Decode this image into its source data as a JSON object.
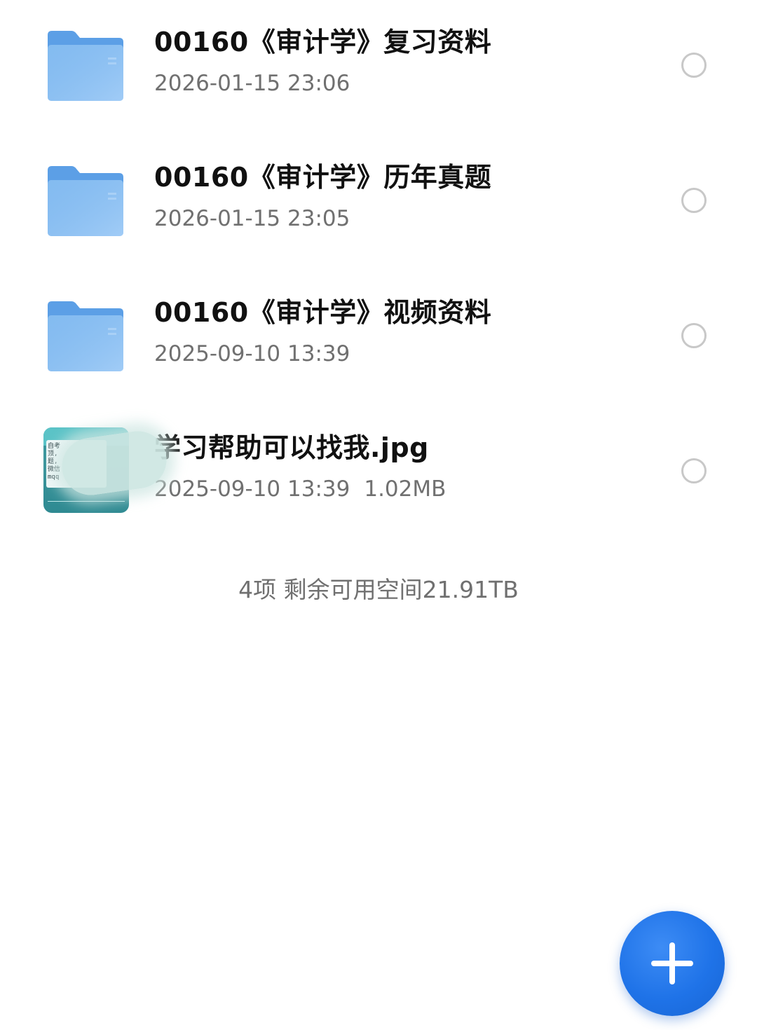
{
  "files": [
    {
      "type": "folder",
      "icon": "folder-icon",
      "name": "00160《审计学》复习资料",
      "modified": "2026-01-15 23:06",
      "size": ""
    },
    {
      "type": "folder",
      "icon": "folder-icon",
      "name": "00160《审计学》历年真题",
      "modified": "2026-01-15 23:05",
      "size": ""
    },
    {
      "type": "folder",
      "icon": "folder-icon",
      "name": "00160《审计学》视频资料",
      "modified": "2025-09-10 13:39",
      "size": ""
    },
    {
      "type": "image",
      "icon": "image-thumbnail",
      "name": "学习帮助可以找我.jpg",
      "modified": "2025-09-10 13:39",
      "size": "1.02MB",
      "thumbnail_text": [
        "自考",
        "顶,",
        "题,",
        "微信",
        "mqq"
      ]
    }
  ],
  "summary": "4项 剩余可用空间21.91TB",
  "fab": {
    "icon": "plus-icon"
  },
  "colors": {
    "folder": "#7fb8f0",
    "folder_tab": "#5c9fe6",
    "fab": "#1f73e8",
    "meta_text": "#707070",
    "title_text": "#111111"
  }
}
